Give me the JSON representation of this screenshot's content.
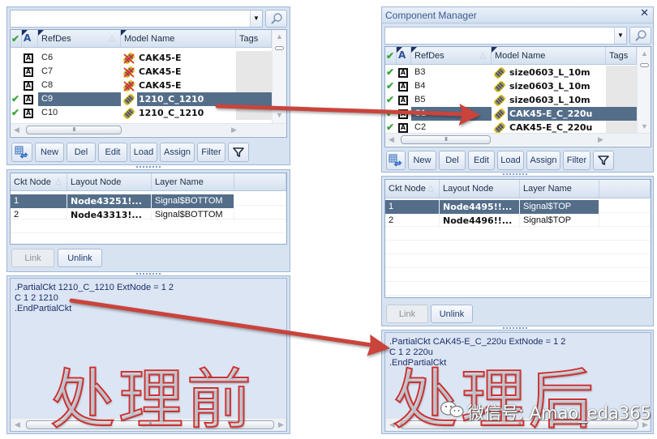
{
  "left_panel": {
    "search": {
      "value": "",
      "placeholder": ""
    },
    "component_grid": {
      "headers": {
        "checked": "",
        "type": "A",
        "refdes": "RefDes",
        "model_name": "Model Name",
        "tags": "Tags"
      },
      "rows": [
        {
          "checked": false,
          "type": "A",
          "refdes": "C6",
          "model_name": "CAK45-E",
          "model_status": "invalid",
          "tags": "",
          "selected": false
        },
        {
          "checked": false,
          "type": "A",
          "refdes": "C7",
          "model_name": "CAK45-E",
          "model_status": "invalid",
          "tags": "",
          "selected": false
        },
        {
          "checked": false,
          "type": "A",
          "refdes": "C8",
          "model_name": "CAK45-E",
          "model_status": "invalid",
          "tags": "",
          "selected": false
        },
        {
          "checked": true,
          "type": "A",
          "refdes": "C9",
          "model_name": "1210_C_1210",
          "model_status": "valid",
          "tags": "",
          "selected": true
        },
        {
          "checked": true,
          "type": "A",
          "refdes": "C10",
          "model_name": "1210_C_1210",
          "model_status": "valid",
          "tags": "",
          "selected": false
        }
      ]
    },
    "toolbar": {
      "new": "New",
      "del": "Del",
      "edit": "Edit",
      "load": "Load",
      "assign": "Assign",
      "filter": "Filter"
    },
    "node_grid": {
      "headers": {
        "ckt_node": "Ckt Node",
        "layout_node": "Layout Node",
        "layer_name": "Layer Name"
      },
      "rows": [
        {
          "ckt_node": "1",
          "layout_node": "Node43251!...",
          "layer_name": "Signal$BOTTOM",
          "selected": true
        },
        {
          "ckt_node": "2",
          "layout_node": "Node43313!...",
          "layer_name": "Signal$BOTTOM",
          "selected": false
        }
      ]
    },
    "link": "Link",
    "unlink": "Unlink",
    "netlist_lines": [
      ".PartialCkt 1210_C_1210 ExtNode = 1 2",
      "C 1 2 1210",
      ".EndPartialCkt"
    ],
    "stage_label": "处理前"
  },
  "right_panel": {
    "title": "Component Manager",
    "search": {
      "value": "",
      "placeholder": ""
    },
    "component_grid": {
      "headers": {
        "checked": "",
        "type": "A",
        "refdes": "RefDes",
        "model_name": "Model Name",
        "tags": "Tags"
      },
      "rows": [
        {
          "checked": true,
          "type": "A",
          "refdes": "B3",
          "model_name": "size0603_L_10m",
          "model_status": "valid",
          "tags": "",
          "selected": false
        },
        {
          "checked": true,
          "type": "A",
          "refdes": "B4",
          "model_name": "size0603_L_10m",
          "model_status": "valid",
          "tags": "",
          "selected": false
        },
        {
          "checked": true,
          "type": "A",
          "refdes": "B5",
          "model_name": "size0603_L_10m",
          "model_status": "valid",
          "tags": "",
          "selected": false
        },
        {
          "checked": true,
          "type": "A",
          "refdes": "C1",
          "model_name": "CAK45-E_C_220u",
          "model_status": "valid",
          "tags": "",
          "selected": true
        },
        {
          "checked": true,
          "type": "A",
          "refdes": "C2",
          "model_name": "CAK45-E_C_220u",
          "model_status": "valid",
          "tags": "",
          "selected": false
        }
      ]
    },
    "toolbar": {
      "new": "New",
      "del": "Del",
      "edit": "Edit",
      "load": "Load",
      "assign": "Assign",
      "filter": "Filter"
    },
    "node_grid": {
      "headers": {
        "ckt_node": "Ckt Node",
        "layout_node": "Layout Node",
        "layer_name": "Layer Name"
      },
      "rows": [
        {
          "ckt_node": "1",
          "layout_node": "Node4495!!...",
          "layer_name": "Signal$TOP",
          "selected": true
        },
        {
          "ckt_node": "2",
          "layout_node": "Node4496!!...",
          "layer_name": "Signal$TOP",
          "selected": false
        }
      ]
    },
    "link": "Link",
    "unlink": "Unlink",
    "netlist_lines": [
      ".PartialCkt CAK45-E_C_220u ExtNode = 1 2",
      "C 1 2 220u",
      ".EndPartialCkt"
    ],
    "stage_label": "处理后"
  },
  "watermark": "微信号: Amao_eda365",
  "colors": {
    "selection": "#546e8a",
    "check": "#3aa53a",
    "arrow": "#c9443c",
    "stage_label": "#cc3333",
    "panel_bg": "#d8e3f1",
    "netlist_text": "#1d2e6c"
  }
}
